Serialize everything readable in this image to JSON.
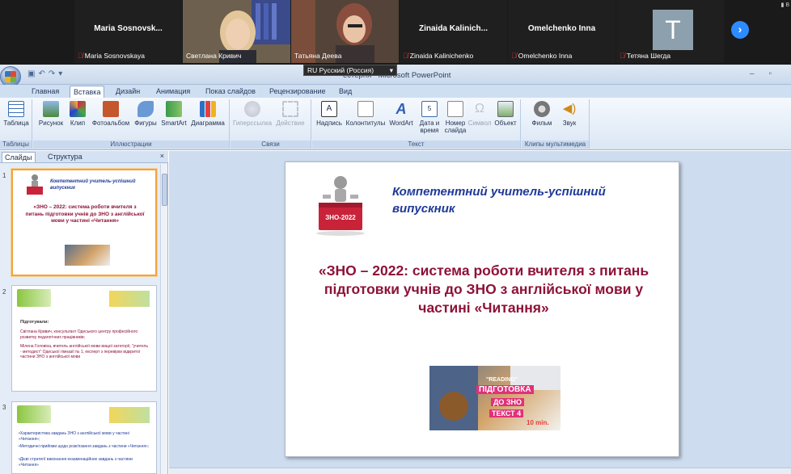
{
  "conference": {
    "tiles": [
      {
        "name": "Maria  Sosnovsk...",
        "label": "Maria Sosnovskaya",
        "muted": true
      },
      {
        "name": "",
        "label": "Светлана Кривич",
        "muted": false
      },
      {
        "name": "",
        "label": "Татьяна Деева",
        "muted": false
      },
      {
        "name": "Zinaida  Kalinich...",
        "label": "Zinaida Kalinichenko",
        "muted": true
      },
      {
        "name": "Omelchenko Inna",
        "label": "Omelchenko Inna",
        "muted": true
      },
      {
        "name": "T",
        "label": "Тетяна Шегда",
        "muted": true
      }
    ],
    "next_icon": "chevron-right-icon"
  },
  "window": {
    "title": "естерня - Microsoft PowerPoint",
    "language_indicator": "RU Русский (Россия)"
  },
  "tabs": [
    "Главная",
    "Вставка",
    "Дизайн",
    "Анимация",
    "Показ слайдов",
    "Рецензирование",
    "Вид"
  ],
  "active_tab": "Вставка",
  "ribbon": {
    "groups": {
      "tables": "Таблицы",
      "illustrations": "Иллюстрации",
      "links": "Связи",
      "text": "Текст",
      "media": "Клипы мультимедиа"
    },
    "buttons": {
      "table": "Таблица",
      "picture": "Рисунок",
      "clip": "Клип",
      "photoalbum": "Фотоальбом",
      "shapes": "Фигуры",
      "smartart": "SmartArt",
      "chart": "Диаграмма",
      "hyperlink": "Гиперссылка",
      "action": "Действие",
      "textbox": "Надпись",
      "header_footer": "Колонтитулы",
      "wordart": "WordArt",
      "datetime": "Дата и время",
      "slide_number": "Номер слайда",
      "symbol": "Символ",
      "object": "Объект",
      "movie": "Фильм",
      "sound": "Звук"
    }
  },
  "pane": {
    "tab_slides": "Слайды",
    "tab_outline": "Структура",
    "close": "×"
  },
  "thumbnails": [
    {
      "num": "1",
      "title": "Компетентний учитель-успішний випускник",
      "body": "«ЗНО – 2022: система роботи вчителя з питань підготовки учнів до ЗНО з англійської мови у частині «Читання»"
    },
    {
      "num": "2",
      "heading": "Підготували:",
      "p1": "Світлана Кривич, консультант Одеського центру професійного розвитку педагогічних працівників;",
      "p2": "Мілена Головіна, вчитель англійської мови вищої категорії, \"учитель - методист\" Одеської гімназії № 1, експерт з перевірки відкритої частини ЗНО з англійської мови"
    },
    {
      "num": "3",
      "p1": "•Характеристика завдань ЗНО з англійської мови у частині «Читання»;",
      "p2": "•Методичні прийоми щодо розв'язання завдань з частини «Читання»;",
      "p3": "•Дієві стратегії виконання екзаменаційних завдань з частини «Читання»"
    }
  ],
  "slide": {
    "subtitle": "Компетентний учитель-успішний випускник",
    "logo_label": "ЗНО-2022",
    "main_text": "«ЗНО – 2022: система роботи вчителя з питань підготовки учнів до ЗНО з англійської мови у частині «Читання»",
    "image_text_1": "\"READING\"",
    "image_text_2": "ПІДГОТОВКА",
    "image_text_3": "ДО ЗНО",
    "image_text_4": "ТЕКСТ 4",
    "image_badge": "10 min."
  }
}
